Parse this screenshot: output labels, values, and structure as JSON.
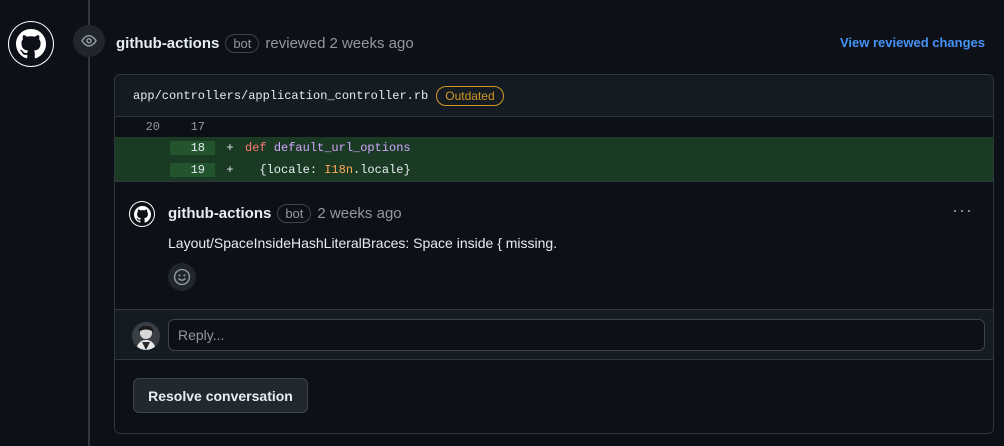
{
  "review": {
    "author": "github-actions",
    "bot_label": "bot",
    "action_text": "reviewed",
    "time": "2 weeks ago",
    "view_changes_label": "View reviewed changes"
  },
  "file": {
    "path": "app/controllers/application_controller.rb",
    "status_badge": "Outdated"
  },
  "diff": {
    "lines": [
      {
        "old": "20",
        "new": "17",
        "sign": "",
        "kind": "context"
      },
      {
        "old": "",
        "new": "18",
        "sign": "+",
        "kind": "add"
      },
      {
        "old": "",
        "new": "19",
        "sign": "+",
        "kind": "add"
      }
    ],
    "line2": {
      "keyword": "def",
      "method": "default_url_options"
    },
    "line3": {
      "open": "{locale: ",
      "const": "I18n",
      "close": ".locale}"
    }
  },
  "comment": {
    "author": "github-actions",
    "bot_label": "bot",
    "time": "2 weeks ago",
    "body": "Layout/SpaceInsideHashLiteralBraces: Space inside { missing.",
    "menu_glyph": "···"
  },
  "reply": {
    "placeholder": "Reply..."
  },
  "resolve": {
    "label": "Resolve conversation"
  },
  "icons": {
    "avatar": "github-mark-icon",
    "badge": "eye-icon",
    "reaction": "smiley-icon",
    "menu": "kebab-horizontal-icon"
  },
  "colors": {
    "link": "#4493f8",
    "outdated": "#d29922",
    "added_bg": "#1b3a24"
  }
}
